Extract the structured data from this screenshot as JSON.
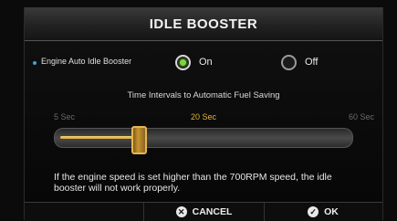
{
  "dialog": {
    "title": "IDLE BOOSTER"
  },
  "auto_idle": {
    "label": "Engine Auto Idle Booster",
    "options": [
      {
        "label": "On",
        "selected": true
      },
      {
        "label": "Off",
        "selected": false
      }
    ]
  },
  "interval": {
    "title": "Time Intervals to Automatic Fuel Saving",
    "min_label": "5 Sec",
    "current_label": "20 Sec",
    "max_label": "60 Sec",
    "min": 5,
    "max": 60,
    "value": 20
  },
  "warning": "If the engine speed is set higher than the 700RPM speed, the idle booster will not work properly.",
  "footer": {
    "cancel_label": "CANCEL",
    "ok_label": "OK",
    "cancel_icon": "x-circle-icon",
    "ok_icon": "check-circle-icon"
  },
  "colors": {
    "accent_green": "#7bd83a",
    "slider_gold": "#e0b23a",
    "bullet_blue": "#3fa5e0"
  }
}
